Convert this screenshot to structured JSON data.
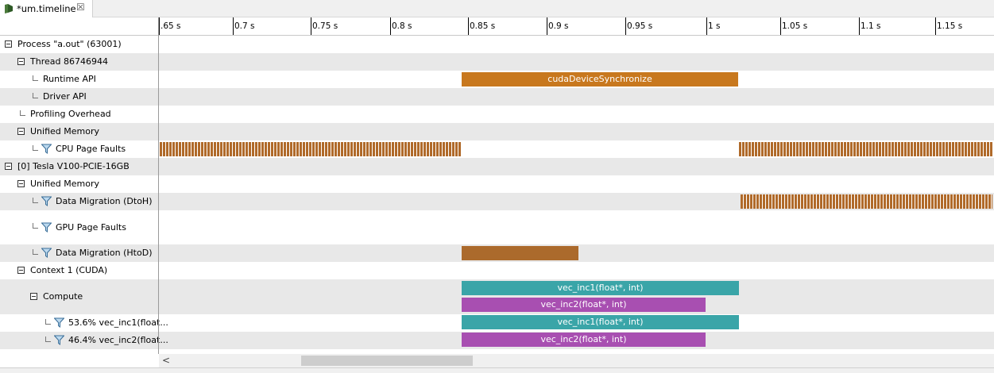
{
  "tab": {
    "title": "*um.timeline",
    "close_glyph": "☒",
    "icon": "timeline-icon"
  },
  "ruler": {
    "ticks": [
      ".65 s",
      "0.7 s",
      "0.75 s",
      "0.8 s",
      "0.85 s",
      "0.9 s",
      "0.95 s",
      "1 s",
      "1.05 s",
      "1.1 s",
      "1.15 s"
    ]
  },
  "tree": [
    {
      "label": "Process \"a.out\" (63001)"
    },
    {
      "label": "Thread 86746944"
    },
    {
      "label": "Runtime API"
    },
    {
      "label": "Driver API"
    },
    {
      "label": "Profiling Overhead"
    },
    {
      "label": "Unified Memory"
    },
    {
      "label": "CPU Page Faults"
    },
    {
      "label": "[0] Tesla V100-PCIE-16GB"
    },
    {
      "label": "Unified Memory"
    },
    {
      "label": "Data Migration (DtoH)"
    },
    {
      "label": "GPU Page Faults"
    },
    {
      "label": "Data Migration (HtoD)"
    },
    {
      "label": "Context 1 (CUDA)"
    },
    {
      "label": "Compute"
    },
    {
      "label": "53.6% vec_inc1(float..."
    },
    {
      "label": "46.4% vec_inc2(float..."
    }
  ],
  "bars": {
    "cudaDeviceSynchronize": "cudaDeviceSynchronize",
    "vec_inc1": "vec_inc1(float*, int)",
    "vec_inc2": "vec_inc2(float*, int)"
  },
  "colors": {
    "api_orange": "#c8781e",
    "migration_brown": "#ab6a2c",
    "kernel_teal": "#3aa5a8",
    "kernel_purple": "#a84fb1"
  },
  "scrollbar": {
    "left_arrow": "<"
  }
}
